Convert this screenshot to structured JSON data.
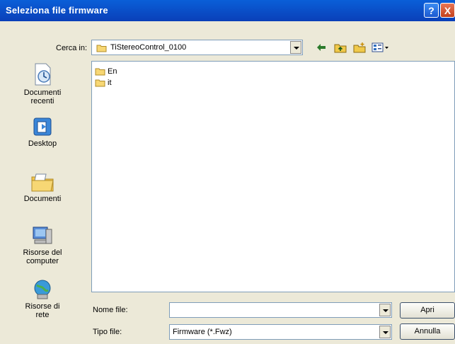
{
  "window": {
    "title": "Seleziona file firmware",
    "help": "?",
    "close": "X"
  },
  "lookin": {
    "label": "Cerca in:",
    "value": "TiStereoControl_0100"
  },
  "places": [
    {
      "label": "Documenti recenti",
      "icon": "recent-documents-icon"
    },
    {
      "label": "Desktop",
      "icon": "desktop-icon"
    },
    {
      "label": "Documenti",
      "icon": "my-documents-icon"
    },
    {
      "label": "Risorse del computer",
      "icon": "my-computer-icon"
    },
    {
      "label": "Risorse di rete",
      "icon": "network-icon"
    }
  ],
  "files": [
    {
      "name": "En",
      "icon": "folder-icon"
    },
    {
      "name": "it",
      "icon": "folder-icon"
    }
  ],
  "filename": {
    "label": "Nome file:",
    "value": ""
  },
  "filetype": {
    "label": "Tipo file:",
    "value": "Firmware  (*.Fwz)"
  },
  "buttons": {
    "open": "Apri",
    "cancel": "Annulla"
  }
}
